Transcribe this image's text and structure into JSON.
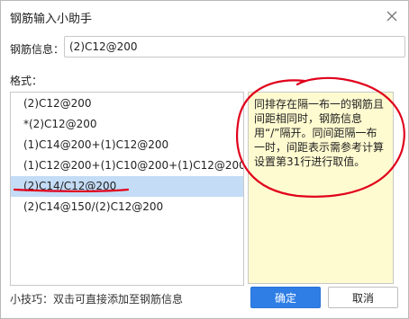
{
  "dialog": {
    "title": "钢筋输入小助手",
    "close_icon": "close-icon"
  },
  "field": {
    "label": "钢筋信息：",
    "value": "(2)C12@200"
  },
  "format": {
    "label": "格式：",
    "items": [
      "(2)C12@200",
      "*(2)C12@200",
      "(1)C14@200+(1)C12@200",
      "(1)C12@200+(1)C10@200+(1)C12@200",
      "(2)C14/C12@200",
      "(2)C14@150/(2)C12@200"
    ],
    "selected_index": 4
  },
  "note": {
    "text": "同排存在隔一布一的钢筋且间距相同时，钢筋信息用“/”隔开。同间距隔一布一时，间距表示需参考计算设置第31行进行取值。"
  },
  "footer": {
    "tip": "小技巧：双击可直接添加至钢筋信息",
    "ok_label": "确定",
    "cancel_label": "取消"
  },
  "colors": {
    "primary_button": "#2f7ee6",
    "selected_row": "#c4dcf6",
    "note_background": "#fffbd0",
    "annotation": "#e0001b"
  }
}
